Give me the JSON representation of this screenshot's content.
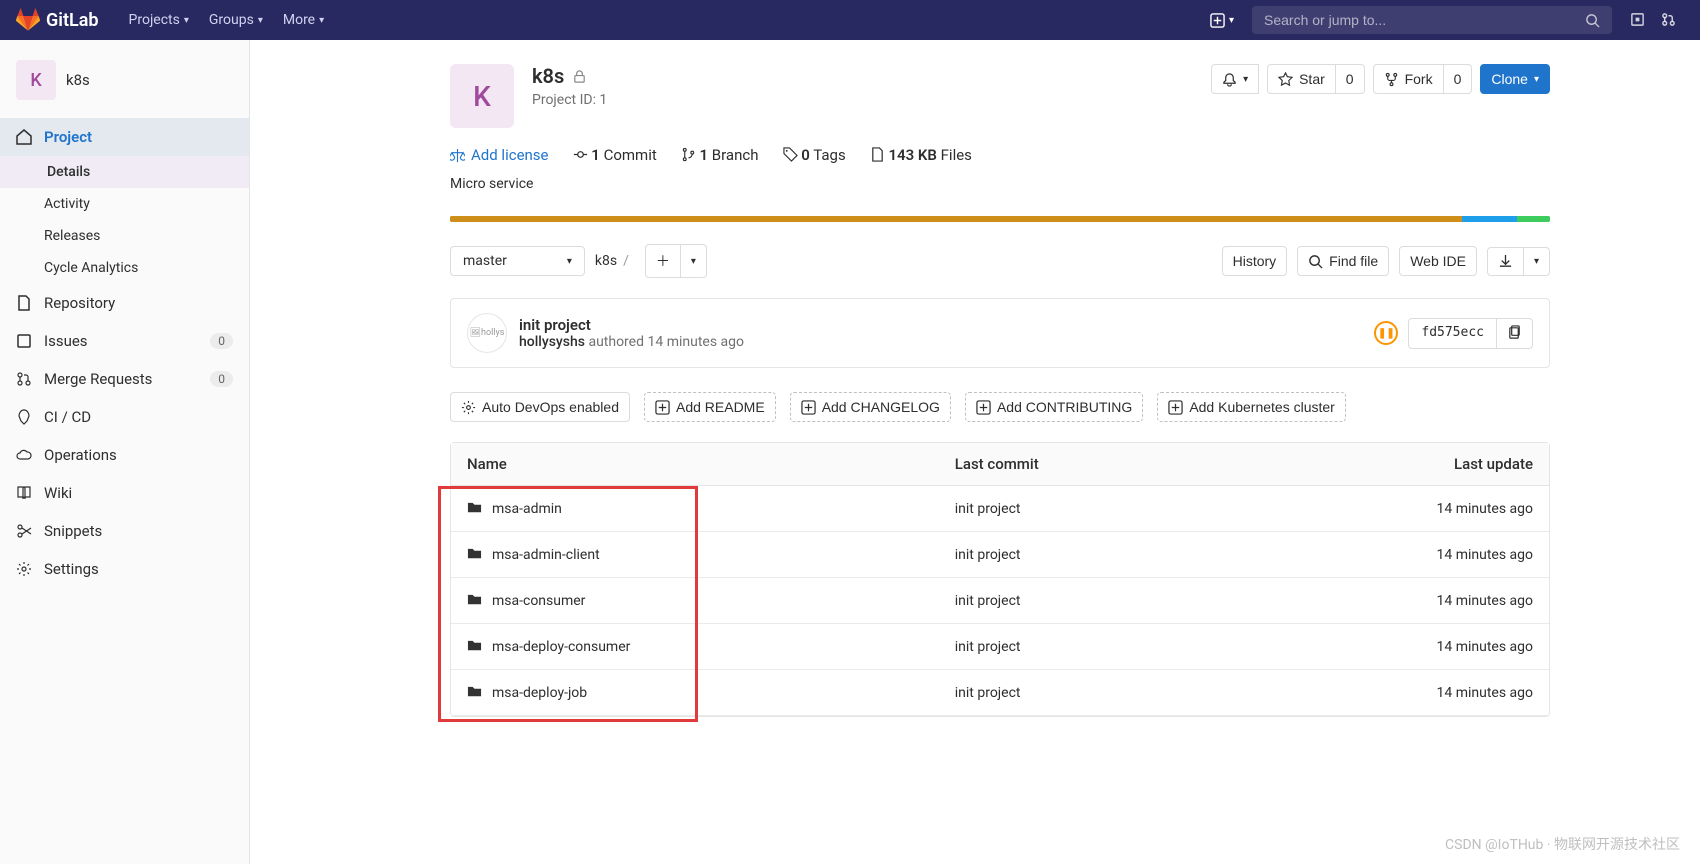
{
  "brand": "GitLab",
  "nav": {
    "projects": "Projects",
    "groups": "Groups",
    "more": "More"
  },
  "search": {
    "placeholder": "Search or jump to..."
  },
  "project": {
    "letter": "K",
    "name": "k8s",
    "id_label": "Project ID: 1",
    "description": "Micro service"
  },
  "actions": {
    "star": "Star",
    "star_count": "0",
    "fork": "Fork",
    "fork_count": "0",
    "clone": "Clone"
  },
  "meta": {
    "add_license": "Add license",
    "commits_n": "1",
    "commits": "Commit",
    "branches_n": "1",
    "branches": "Branch",
    "tags_n": "0",
    "tags": "Tags",
    "files_n": "143 KB",
    "files": "Files"
  },
  "sidebar": {
    "project": "Project",
    "details": "Details",
    "activity": "Activity",
    "releases": "Releases",
    "cycle": "Cycle Analytics",
    "repository": "Repository",
    "issues": "Issues",
    "issues_count": "0",
    "mr": "Merge Requests",
    "mr_count": "0",
    "cicd": "CI / CD",
    "operations": "Operations",
    "wiki": "Wiki",
    "snippets": "Snippets",
    "settings": "Settings"
  },
  "tree": {
    "branch": "master",
    "root": "k8s",
    "history": "History",
    "findfile": "Find file",
    "webide": "Web IDE"
  },
  "commit": {
    "title": "init project",
    "avatar_alt": "hollys",
    "author": "hollysyshs",
    "authored": "authored",
    "time": "14 minutes ago",
    "sha": "fd575ecc"
  },
  "addfile": {
    "devops": "Auto DevOps enabled",
    "readme": "Add README",
    "changelog": "Add CHANGELOG",
    "contributing": "Add CONTRIBUTING",
    "k8s": "Add Kubernetes cluster"
  },
  "table": {
    "col_name": "Name",
    "col_commit": "Last commit",
    "col_update": "Last update",
    "rows": [
      {
        "name": "msa-admin",
        "commit": "init project",
        "time": "14 minutes ago"
      },
      {
        "name": "msa-admin-client",
        "commit": "init project",
        "time": "14 minutes ago"
      },
      {
        "name": "msa-consumer",
        "commit": "init project",
        "time": "14 minutes ago"
      },
      {
        "name": "msa-deploy-consumer",
        "commit": "init project",
        "time": "14 minutes ago"
      },
      {
        "name": "msa-deploy-job",
        "commit": "init project",
        "time": "14 minutes ago"
      }
    ]
  },
  "watermark": "CSDN @IoTHub · 物联网开源技术社区"
}
